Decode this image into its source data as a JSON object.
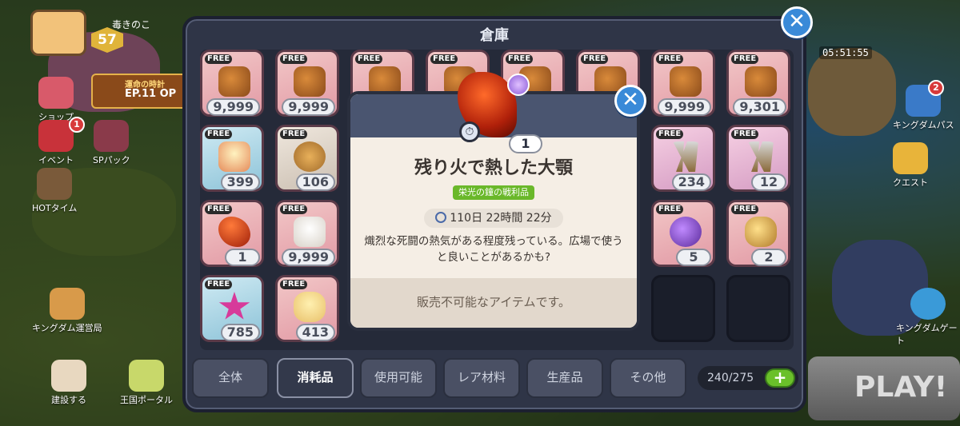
{
  "background": {
    "player_level": "57",
    "player_name": "毒きのこ",
    "episode_title": "運命の時計",
    "episode_label": "EP.11 OP",
    "timer": "05:51:55",
    "left_menu": [
      {
        "label": "ショップ",
        "badge": ""
      },
      {
        "label": "イベント",
        "badge": "1"
      },
      {
        "label": "SPパック",
        "badge": ""
      },
      {
        "label": "HOTタイム",
        "badge": ""
      },
      {
        "label": "キングダム運営局",
        "badge": ""
      },
      {
        "label": "建設する",
        "badge": ""
      },
      {
        "label": "王国ポータル",
        "badge": ""
      }
    ],
    "right_menu": [
      {
        "label": "キングダムパス",
        "badge": "2"
      },
      {
        "label": "クエスト",
        "badge": ""
      },
      {
        "label": "キングダムゲート",
        "badge": ""
      }
    ],
    "play_label": "PLAY!"
  },
  "storage": {
    "title": "倉庫",
    "close_label": "✕",
    "free_label": "FREE",
    "slots_row1": [
      {
        "count": "9,999",
        "free": true,
        "kind": "choco"
      },
      {
        "count": "9,999",
        "free": true,
        "kind": "choco"
      },
      {
        "count": "",
        "free": true,
        "kind": "choco"
      },
      {
        "count": "",
        "free": true,
        "kind": "choco"
      },
      {
        "count": "",
        "free": true,
        "kind": "choco"
      },
      {
        "count": "",
        "free": true,
        "kind": "choco"
      },
      {
        "count": "9,999",
        "free": true,
        "kind": "choco"
      },
      {
        "count": "9,301",
        "free": true,
        "kind": "choco"
      }
    ],
    "slots_row2": [
      {
        "count": "399",
        "free": true,
        "kind": "cake"
      },
      {
        "count": "106",
        "free": true,
        "kind": "cookie"
      },
      {
        "count": "234",
        "free": true,
        "kind": "claw"
      },
      {
        "count": "12",
        "free": true,
        "kind": "claw"
      }
    ],
    "slots_row3": [
      {
        "count": "1",
        "free": true,
        "kind": "jaw"
      },
      {
        "count": "9,999",
        "free": true,
        "kind": "sugar"
      },
      {
        "count": "5",
        "free": true,
        "kind": "gem"
      },
      {
        "count": "2",
        "free": true,
        "kind": "gold"
      }
    ],
    "slots_row4": [
      {
        "count": "785",
        "free": true,
        "kind": "star"
      },
      {
        "count": "413",
        "free": true,
        "kind": "pop"
      }
    ],
    "tabs": [
      "全体",
      "消耗品",
      "使用可能",
      "レア材料",
      "生産品",
      "その他"
    ],
    "active_tab": "消耗品",
    "capacity": "240/275",
    "add_label": "+"
  },
  "detail": {
    "item_name": "残り火で熱した大顎",
    "count": "1",
    "category_tag": "栄光の鐘の戦利品",
    "remaining_time": "110日 22時間 22分",
    "description": "熾烈な死闘の熱気がある程度残っている。広場で使うと良いことがあるかも?",
    "footer": "販売不可能なアイテムです。",
    "close_label": "✕"
  }
}
